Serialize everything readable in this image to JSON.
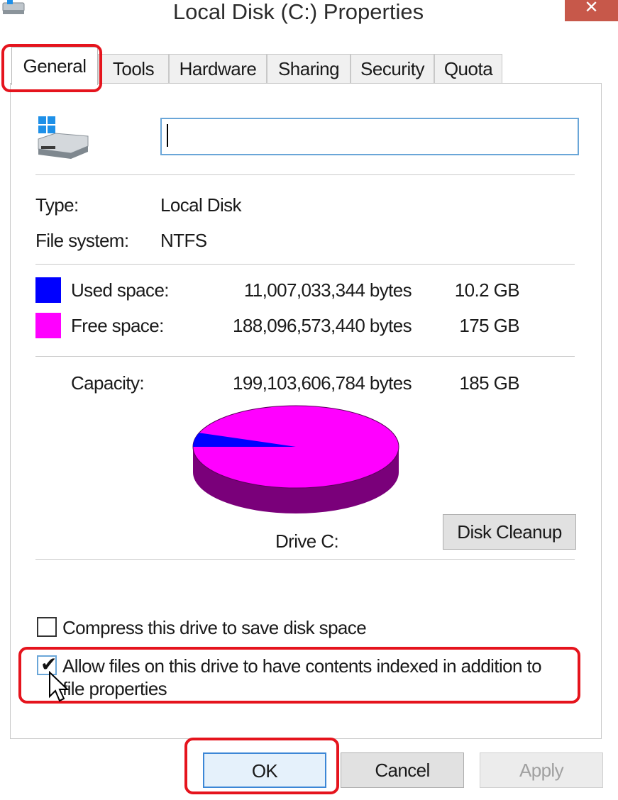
{
  "window": {
    "title": "Local Disk (C:) Properties",
    "close_glyph": "✕",
    "icon": "drive-icon"
  },
  "tabs": [
    {
      "label": "General",
      "active": true
    },
    {
      "label": "Tools",
      "active": false
    },
    {
      "label": "Hardware",
      "active": false
    },
    {
      "label": "Sharing",
      "active": false
    },
    {
      "label": "Security",
      "active": false
    },
    {
      "label": "Quota",
      "active": false
    }
  ],
  "general": {
    "drive_icon": "windows-drive-icon",
    "name_value": "",
    "type_label": "Type:",
    "type_value": "Local Disk",
    "fs_label": "File system:",
    "fs_value": "NTFS",
    "used": {
      "label": "Used space:",
      "bytes": "11,007,033,344 bytes",
      "size": "10.2 GB",
      "color": "#0000ff"
    },
    "free": {
      "label": "Free space:",
      "bytes": "188,096,573,440 bytes",
      "size": "175 GB",
      "color": "#ff00ff"
    },
    "capacity": {
      "label": "Capacity:",
      "bytes": "199,103,606,784 bytes",
      "size": "185 GB"
    },
    "drive_label": "Drive C:",
    "disk_cleanup_label": "Disk Cleanup",
    "used_fraction": 0.0553,
    "compress_label": "Compress this drive to save disk space",
    "compress_checked": false,
    "index_label_line1": "Allow files on this drive to have contents indexed in addition to",
    "index_label_line2": "file properties",
    "index_checked": true
  },
  "footer": {
    "ok_label": "OK",
    "cancel_label": "Cancel",
    "apply_label": "Apply"
  },
  "colors": {
    "accent": "#3c87d6",
    "highlight": "#e5141d",
    "pie_free": "#ff00ff",
    "pie_free_side": "#7a007a",
    "pie_used": "#0000ff"
  }
}
